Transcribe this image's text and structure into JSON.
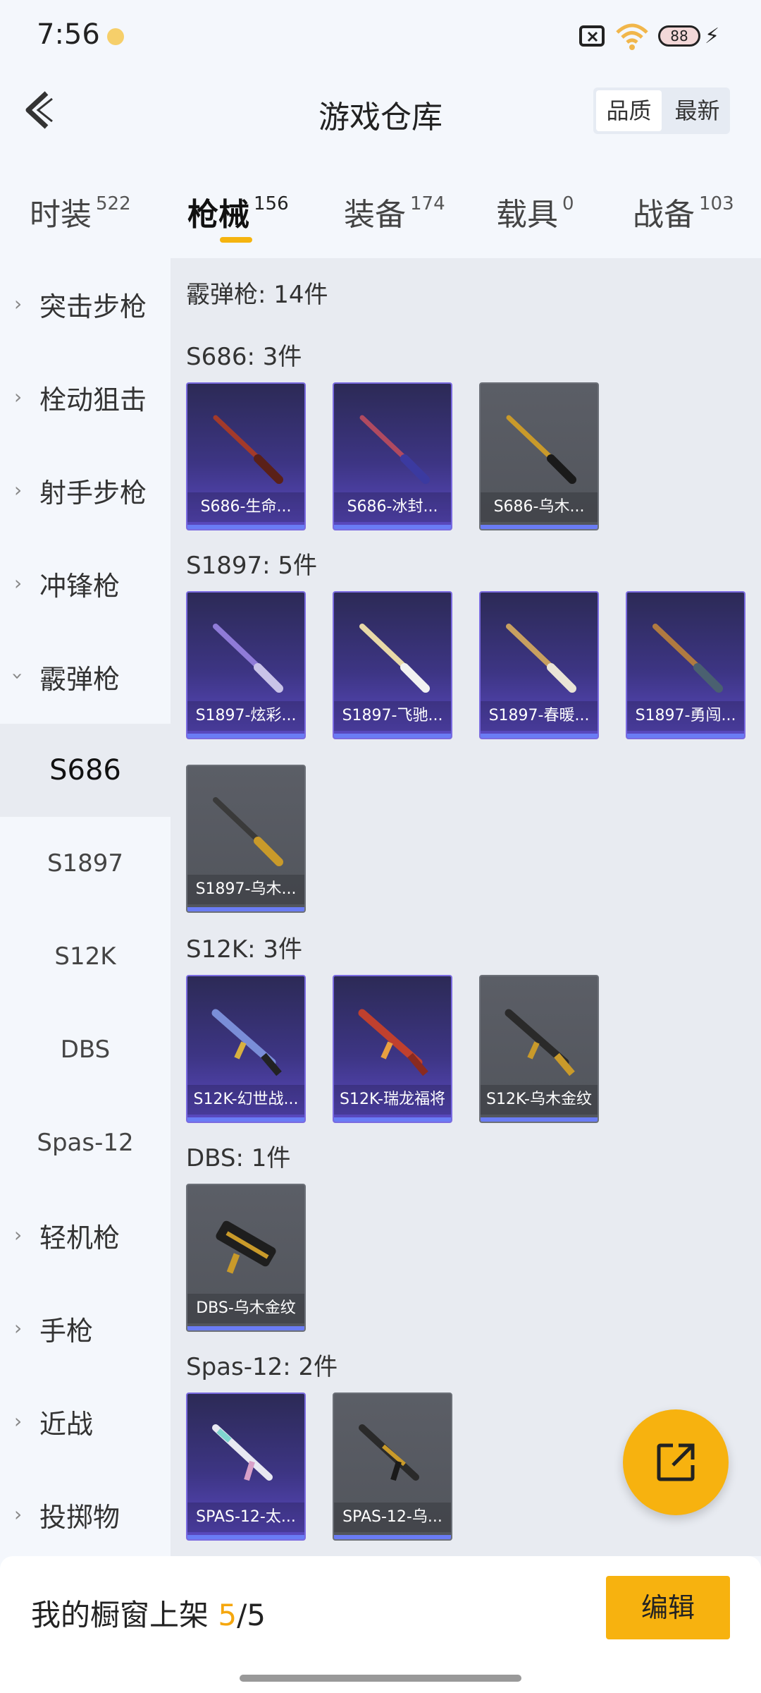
{
  "status_bar": {
    "time": "7:56",
    "battery": "88"
  },
  "header": {
    "title": "游戏仓库",
    "sort": [
      "品质",
      "最新"
    ]
  },
  "tabs": [
    {
      "label": "时装",
      "count": "522"
    },
    {
      "label": "枪械",
      "count": "156"
    },
    {
      "label": "装备",
      "count": "174"
    },
    {
      "label": "载具",
      "count": "0"
    },
    {
      "label": "战备",
      "count": "103"
    }
  ],
  "sidebar": {
    "categories": [
      "突击步枪",
      "栓动狙击",
      "射手步枪",
      "冲锋枪",
      "霰弹枪",
      "轻机枪",
      "手枪",
      "近战",
      "投掷物"
    ],
    "subitems": [
      "S686",
      "S1897",
      "S12K",
      "DBS",
      "Spas-12"
    ]
  },
  "content": {
    "summary": "霰弹枪: 14件",
    "sections": [
      {
        "title": "S686: 3件",
        "items": [
          "S686-生命...",
          "S686-冰封...",
          "S686-乌木..."
        ]
      },
      {
        "title": "S1897: 5件",
        "items": [
          "S1897-炫彩...",
          "S1897-飞驰...",
          "S1897-春暖...",
          "S1897-勇闯...",
          "S1897-乌木..."
        ]
      },
      {
        "title": "S12K: 3件",
        "items": [
          "S12K-幻世战...",
          "S12K-瑞龙福将",
          "S12K-乌木金纹"
        ]
      },
      {
        "title": "DBS: 1件",
        "items": [
          "DBS-乌木金纹"
        ]
      },
      {
        "title": "Spas-12: 2件",
        "items": [
          "SPAS-12-太...",
          "SPAS-12-乌..."
        ]
      }
    ]
  },
  "bottom": {
    "label": "我的橱窗上架",
    "current": "5",
    "total": "/5",
    "edit": "编辑"
  },
  "colors": {
    "accent": "#f7b20f",
    "purple_card": "#3d3584",
    "gray_card": "#52555c"
  }
}
